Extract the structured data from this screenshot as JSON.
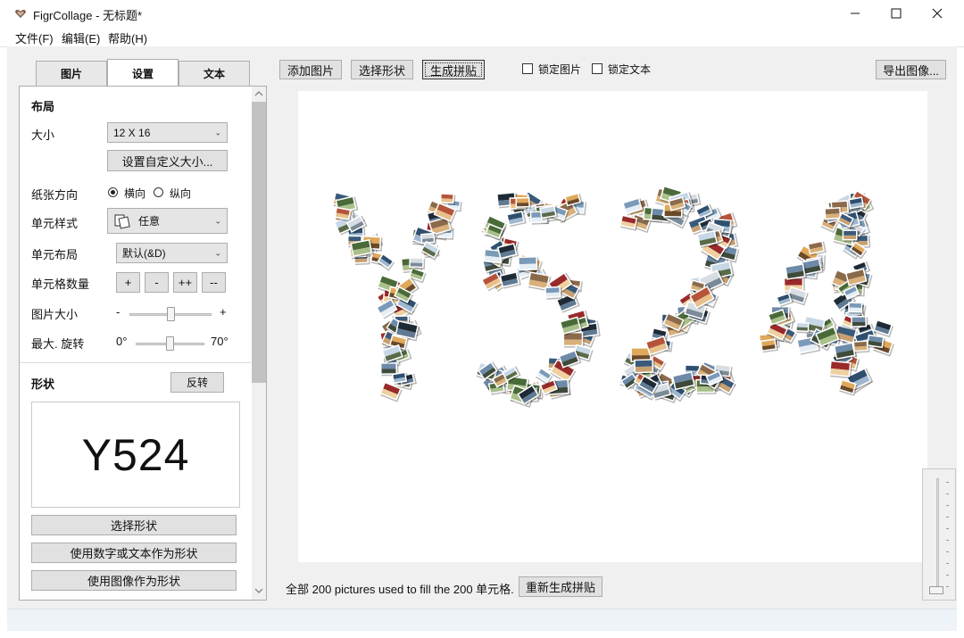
{
  "window": {
    "title": "FigrCollage - 无标题*"
  },
  "menu": {
    "file": "文件(F)",
    "edit": "编辑(E)",
    "help": "帮助(H)"
  },
  "tabs": {
    "pictures": "图片",
    "settings": "设置",
    "text": "文本"
  },
  "layout": {
    "heading": "布局",
    "size_label": "大小",
    "size_value": "12 X 16",
    "custom_size_button": "设置自定义大小...",
    "orientation_label": "纸张方向",
    "landscape": "横向",
    "portrait": "纵向",
    "orientation_selected": "横向",
    "cell_style_label": "单元样式",
    "cell_style_value": "任意",
    "cell_layout_label": "单元布局",
    "cell_layout_value": "默认(&D)",
    "cell_count_label": "单元格数量",
    "cell_count_buttons": [
      "+",
      "-",
      "++",
      "--"
    ],
    "picture_size_label": "图片大小",
    "picture_size_min": "-",
    "picture_size_max": "+",
    "picture_size_level": 0.5,
    "rotation_label": "最大. 旋转",
    "rotation_min": "0°",
    "rotation_max": "70°",
    "rotation_level": 0.5
  },
  "shape": {
    "heading": "形状",
    "invert_button": "反转",
    "preview_text": "Y524",
    "select_shape_button": "选择形状",
    "use_text_button": "使用数字或文本作为形状",
    "use_image_button": "使用图像作为形状"
  },
  "toolbar": {
    "add_pictures": "添加图片",
    "select_shape": "选择形状",
    "generate": "生成拼贴",
    "lock_pictures": "锁定图片",
    "lock_text": "锁定文本",
    "export": "导出图像..."
  },
  "collage": {
    "shape_text": "Y524"
  },
  "footer": {
    "status_text": "全部 200 pictures used to fill the 200 单元格.",
    "regenerate_button": "重新生成拼贴"
  },
  "icons": {
    "app": "heart-icon",
    "minimize": "minimize-icon",
    "maximize": "maximize-icon",
    "close": "close-icon",
    "scroll_up": "scroll-up-icon",
    "scroll_down": "scroll-down-icon",
    "chevron": "chevron-down-icon",
    "cell_style": "cell-style-icon"
  },
  "colors": {
    "work_bg": "#f0f0f0",
    "canvas_bg": "#ffffff",
    "status_bg": "#eef3f8",
    "button_bg": "#e1e1e1"
  }
}
